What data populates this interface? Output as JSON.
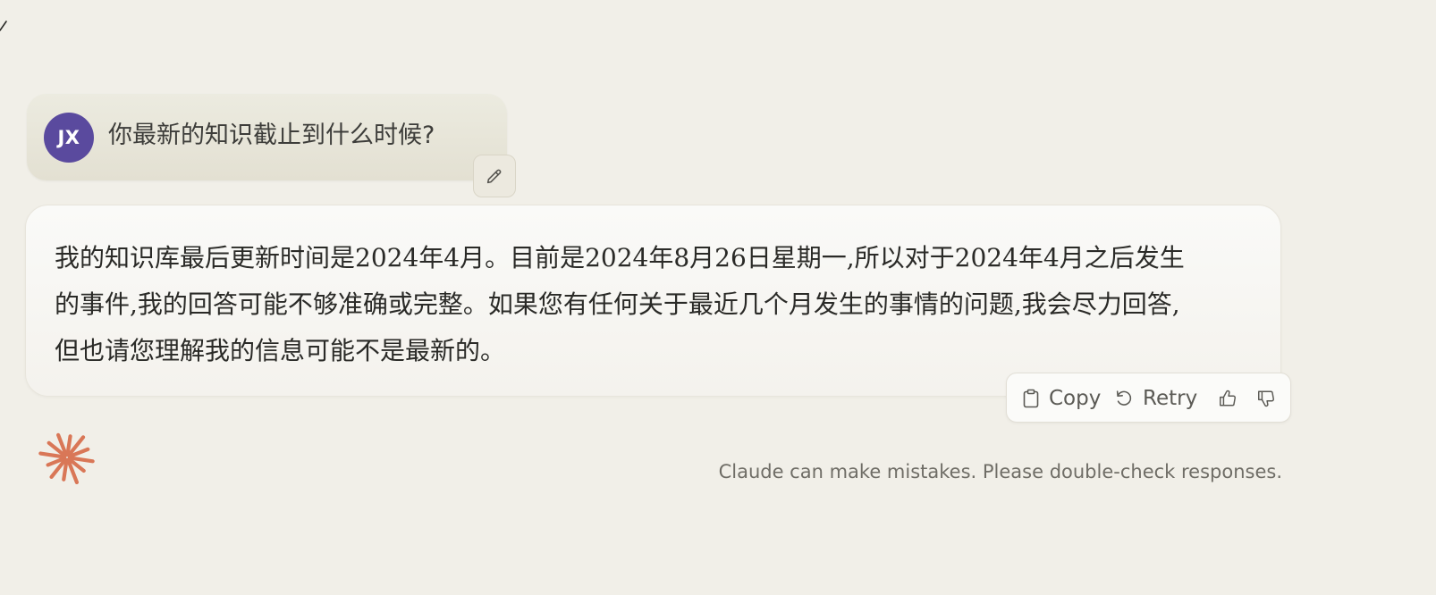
{
  "conversation": {
    "user_message": {
      "avatar_initials": "JX",
      "text": "你最新的知识截止到什么时候?"
    },
    "assistant_message": {
      "text": "我的知识库最后更新时间是2024年4月。目前是2024年8月26日星期一,所以对于2024年4月之后发生的事件,我的回答可能不够准确或完整。如果您有任何关于最近几个月发生的事情的问题,我会尽力回答,但也请您理解我的信息可能不是最新的。"
    }
  },
  "actions": {
    "copy_label": "Copy",
    "retry_label": "Retry"
  },
  "footer": {
    "disclaimer": "Claude can make mistakes. Please double-check responses."
  },
  "colors": {
    "background": "#f1efe8",
    "avatar": "#5a4a9e",
    "claude_logo": "#d97757"
  },
  "icons": {
    "edit": "pencil-icon",
    "copy": "clipboard-icon",
    "retry": "retry-icon",
    "thumbs_up": "thumbs-up-icon",
    "thumbs_down": "thumbs-down-icon",
    "logo": "claude-starburst-logo"
  }
}
